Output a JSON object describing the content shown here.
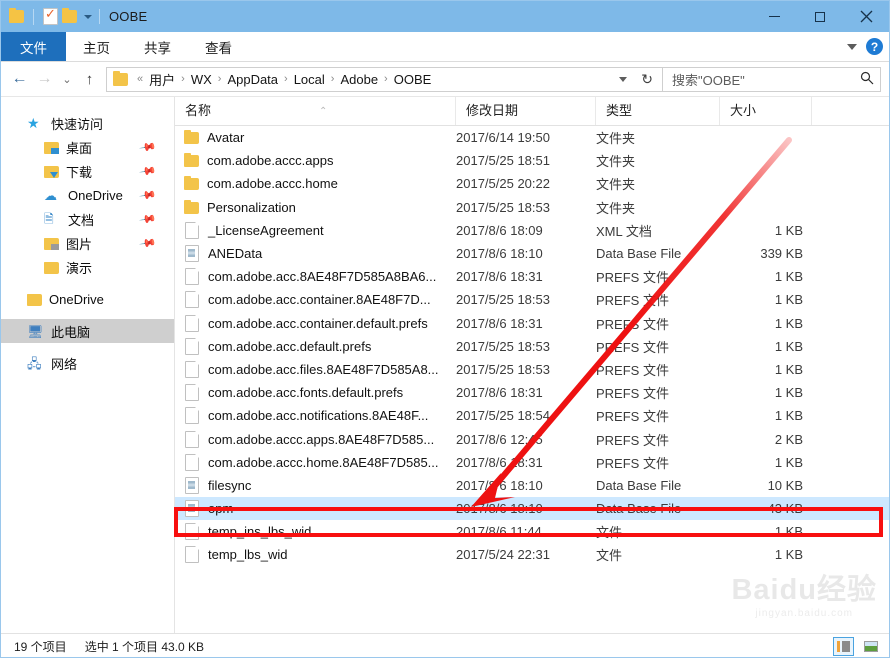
{
  "window": {
    "title": "OOBE",
    "quick_access_icons": [
      "folder-icon",
      "properties-check-icon",
      "new-folder-icon",
      "customize-dropdown-icon"
    ],
    "controls": {
      "minimize": "—",
      "maximize": "□",
      "close": "✕"
    }
  },
  "ribbon": {
    "tabs": [
      {
        "label": "文件",
        "active": true
      },
      {
        "label": "主页",
        "active": false
      },
      {
        "label": "共享",
        "active": false
      },
      {
        "label": "查看",
        "active": false
      }
    ],
    "expand_label": "⌄",
    "help_label": "?"
  },
  "address": {
    "back": "←",
    "forward": "→",
    "recent": "⌄",
    "up": "↑",
    "root_prefix": "«",
    "crumbs": [
      "用户",
      "WX",
      "AppData",
      "Local",
      "Adobe",
      "OOBE"
    ],
    "separator": "›",
    "refresh": "↻"
  },
  "search": {
    "placeholder": "搜索\"OOBE\"",
    "value": "搜索\"OOBE\"",
    "icon": "search-icon"
  },
  "sidebar": {
    "items": [
      {
        "label": "快速访问",
        "icon": "star-icon",
        "indent": false,
        "pinned": false,
        "selected": false
      },
      {
        "label": "桌面",
        "icon": "desktop-folder-icon",
        "indent": true,
        "pinned": true,
        "selected": false
      },
      {
        "label": "下载",
        "icon": "downloads-folder-icon",
        "indent": true,
        "pinned": true,
        "selected": false
      },
      {
        "label": "OneDrive",
        "icon": "onedrive-cloud-icon",
        "indent": true,
        "pinned": true,
        "selected": false
      },
      {
        "label": "文档",
        "icon": "documents-folder-icon",
        "indent": true,
        "pinned": true,
        "selected": false
      },
      {
        "label": "图片",
        "icon": "pictures-folder-icon",
        "indent": true,
        "pinned": true,
        "selected": false
      },
      {
        "label": "演示",
        "icon": "folder-icon",
        "indent": true,
        "pinned": false,
        "selected": false
      },
      {
        "label": "OneDrive",
        "icon": "folder-icon",
        "indent": false,
        "pinned": false,
        "selected": false
      },
      {
        "label": "此电脑",
        "icon": "this-pc-icon",
        "indent": false,
        "pinned": false,
        "selected": true
      },
      {
        "label": "网络",
        "icon": "network-icon",
        "indent": false,
        "pinned": false,
        "selected": false
      }
    ]
  },
  "file_list": {
    "columns": [
      {
        "key": "name",
        "label": "名称"
      },
      {
        "key": "date",
        "label": "修改日期"
      },
      {
        "key": "type",
        "label": "类型"
      },
      {
        "key": "size",
        "label": "大小"
      }
    ],
    "sort_indicator": "⌃",
    "rows": [
      {
        "name": "Avatar",
        "date": "2017/6/14 19:50",
        "type": "文件夹",
        "size": "",
        "icon": "folder",
        "selected": false
      },
      {
        "name": "com.adobe.accc.apps",
        "date": "2017/5/25 18:51",
        "type": "文件夹",
        "size": "",
        "icon": "folder",
        "selected": false
      },
      {
        "name": "com.adobe.accc.home",
        "date": "2017/5/25 20:22",
        "type": "文件夹",
        "size": "",
        "icon": "folder",
        "selected": false
      },
      {
        "name": "Personalization",
        "date": "2017/5/25 18:53",
        "type": "文件夹",
        "size": "",
        "icon": "folder",
        "selected": false
      },
      {
        "name": "_LicenseAgreement",
        "date": "2017/8/6 18:09",
        "type": "XML 文档",
        "size": "1 KB",
        "icon": "file",
        "selected": false
      },
      {
        "name": "ANEData",
        "date": "2017/8/6 18:10",
        "type": "Data Base File",
        "size": "339 KB",
        "icon": "db",
        "selected": false
      },
      {
        "name": "com.adobe.acc.8AE48F7D585A8BA6...",
        "date": "2017/8/6 18:31",
        "type": "PREFS 文件",
        "size": "1 KB",
        "icon": "file",
        "selected": false
      },
      {
        "name": "com.adobe.acc.container.8AE48F7D...",
        "date": "2017/5/25 18:53",
        "type": "PREFS 文件",
        "size": "1 KB",
        "icon": "file",
        "selected": false
      },
      {
        "name": "com.adobe.acc.container.default.prefs",
        "date": "2017/8/6 18:31",
        "type": "PREFS 文件",
        "size": "1 KB",
        "icon": "file",
        "selected": false
      },
      {
        "name": "com.adobe.acc.default.prefs",
        "date": "2017/5/25 18:53",
        "type": "PREFS 文件",
        "size": "1 KB",
        "icon": "file",
        "selected": false
      },
      {
        "name": "com.adobe.acc.files.8AE48F7D585A8...",
        "date": "2017/5/25 18:53",
        "type": "PREFS 文件",
        "size": "1 KB",
        "icon": "file",
        "selected": false
      },
      {
        "name": "com.adobe.acc.fonts.default.prefs",
        "date": "2017/8/6 18:31",
        "type": "PREFS 文件",
        "size": "1 KB",
        "icon": "file",
        "selected": false
      },
      {
        "name": "com.adobe.acc.notifications.8AE48F...",
        "date": "2017/5/25 18:54",
        "type": "PREFS 文件",
        "size": "1 KB",
        "icon": "file",
        "selected": false
      },
      {
        "name": "com.adobe.accc.apps.8AE48F7D585...",
        "date": "2017/8/6 12:45",
        "type": "PREFS 文件",
        "size": "2 KB",
        "icon": "file",
        "selected": false
      },
      {
        "name": "com.adobe.accc.home.8AE48F7D585...",
        "date": "2017/8/6 18:31",
        "type": "PREFS 文件",
        "size": "1 KB",
        "icon": "file",
        "selected": false
      },
      {
        "name": "filesync",
        "date": "2017/8/6 18:10",
        "type": "Data Base File",
        "size": "10 KB",
        "icon": "db",
        "selected": false
      },
      {
        "name": "opm",
        "date": "2017/8/6 18:10",
        "type": "Data Base File",
        "size": "43 KB",
        "icon": "db",
        "selected": true
      },
      {
        "name": "temp_ins_lbs_wid",
        "date": "2017/8/6 11:44",
        "type": "文件",
        "size": "1 KB",
        "icon": "file",
        "selected": false
      },
      {
        "name": "temp_lbs_wid",
        "date": "2017/5/24 22:31",
        "type": "文件",
        "size": "1 KB",
        "icon": "file",
        "selected": false
      }
    ]
  },
  "watermark": {
    "main": "Baidu经验",
    "sub": "jingyan.baidu.com"
  },
  "status": {
    "item_count": "19 个项目",
    "selection": "选中 1 个项目  43.0 KB",
    "view_details_label": "details-view",
    "view_large_label": "large-icons-view"
  },
  "annotations": {
    "highlight_color": "#f80f0f",
    "arrow_color": "#ee1111"
  }
}
